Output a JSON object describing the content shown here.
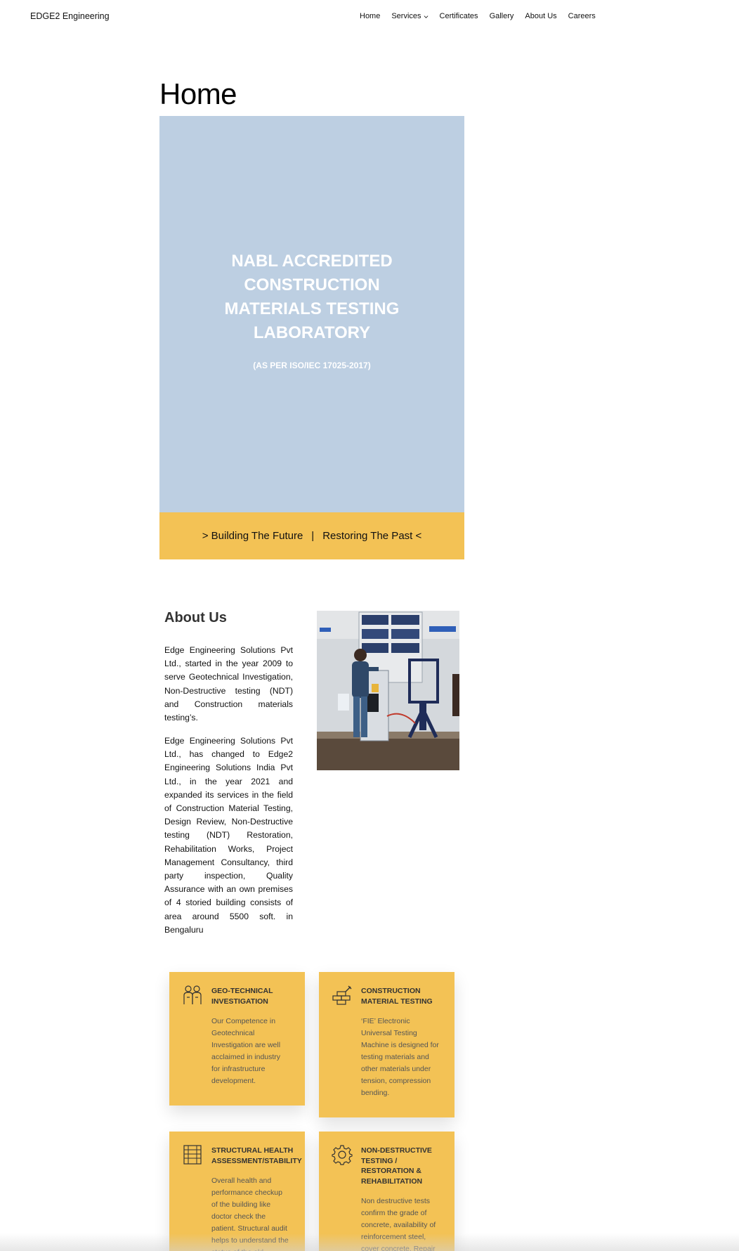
{
  "header": {
    "site_title": "EDGE2 Engineering",
    "nav": [
      "Home",
      "Services",
      "Certificates",
      "Gallery",
      "About Us",
      "Careers"
    ]
  },
  "page": {
    "title": "Home"
  },
  "hero": {
    "heading": "NABL ACCREDITED CONSTRUCTION MATERIALS TESTING LABORATORY",
    "subheading": "(AS PER ISO/IEC 17025-2017)",
    "background": "#bdcfe2"
  },
  "tagline": {
    "left": "> Building The Future",
    "separator": "|",
    "right": "Restoring The Past <",
    "background": "#f3c255"
  },
  "about": {
    "heading": "About Us",
    "paragraph1": "Edge Engineering Solutions Pvt Ltd., started in the year 2009 to serve Geotechnical Investigation, Non-Destructive testing (NDT) and Construction materials testing’s.",
    "paragraph2": "Edge Engineering Solutions Pvt Ltd., has changed to Edge2 Engineering Solutions India Pvt Ltd., in the year 2021 and expanded its services in the field of Construction Material Testing, Design Review, Non-Destructive testing (NDT) Restoration, Rehabilitation Works, Project Management Consultancy, third party inspection, Quality Assurance with an own premises of 4 storied building consists of area around 5500 soft. in Bengaluru"
  },
  "services": [
    {
      "title": "GEO-TECHNICAL INVESTIGATION",
      "text": "Our Competence in Geotechnical Investigation are well acclaimed in industry for infrastructure development.",
      "icon": "workers-icon"
    },
    {
      "title": "CONSTRUCTION MATERIAL TESTING",
      "text": "‘FIE’ Electronic Universal Testing Machine is designed for testing materials and other materials under tension, compression bending.",
      "icon": "bricks-trowel-icon"
    },
    {
      "title": "STRUCTURAL HEALTH ASSESSMENT/STABILITY",
      "text": "Overall health and performance checkup of the building like doctor check the patient. Structural audit helps to understand the status of the old building",
      "icon": "building-icon"
    },
    {
      "title": "NON-DESTRUCTIVE TESTING / RESTORATION & REHABILITATION",
      "text": "Non destructive tests confirm the grade of concrete, availability of reinforcement steel, cover concrete. Repair",
      "icon": "gear-icon"
    }
  ]
}
